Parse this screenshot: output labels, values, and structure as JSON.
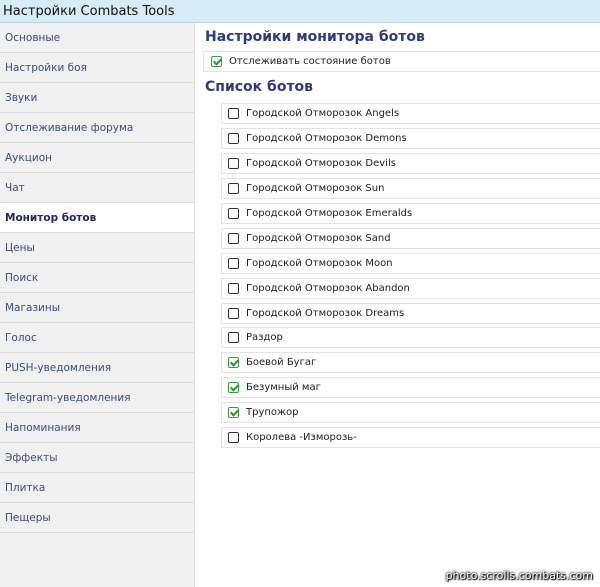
{
  "window": {
    "title": "Настройки Combats Tools"
  },
  "sidebar": {
    "items": [
      {
        "label": "Основные",
        "active": false
      },
      {
        "label": "Настройки боя",
        "active": false
      },
      {
        "label": "Звуки",
        "active": false
      },
      {
        "label": "Отслеживание форума",
        "active": false
      },
      {
        "label": "Аукцион",
        "active": false
      },
      {
        "label": "Чат",
        "active": false
      },
      {
        "label": "Монитор ботов",
        "active": true
      },
      {
        "label": "Цены",
        "active": false
      },
      {
        "label": "Поиск",
        "active": false
      },
      {
        "label": "Магазины",
        "active": false
      },
      {
        "label": "Голос",
        "active": false
      },
      {
        "label": "PUSH-уведомления",
        "active": false
      },
      {
        "label": "Telegram-уведомления",
        "active": false
      },
      {
        "label": "Напоминания",
        "active": false
      },
      {
        "label": "Эффекты",
        "active": false
      },
      {
        "label": "Плитка",
        "active": false
      },
      {
        "label": "Пещеры",
        "active": false
      }
    ]
  },
  "main": {
    "monitor_title": "Настройки монитора ботов",
    "tracking": {
      "label": "Отслеживать состояние ботов",
      "checked": true
    },
    "bots_title": "Список ботов",
    "bots": [
      {
        "label": "Городской Отморозок Angels",
        "checked": false
      },
      {
        "label": "Городской Отморозок Demons",
        "checked": false
      },
      {
        "label": "Городской Отморозок Devils",
        "checked": false
      },
      {
        "label": "Городской Отморозок Sun",
        "checked": false
      },
      {
        "label": "Городской Отморозок Emeralds",
        "checked": false
      },
      {
        "label": "Городской Отморозок Sand",
        "checked": false
      },
      {
        "label": "Городской Отморозок Moon",
        "checked": false
      },
      {
        "label": "Городской Отморозок Abandon",
        "checked": false
      },
      {
        "label": "Городской Отморозок Dreams",
        "checked": false
      },
      {
        "label": "Раздор",
        "checked": false
      },
      {
        "label": "Боевой Бугаг",
        "checked": true
      },
      {
        "label": "Безумный маг",
        "checked": true
      },
      {
        "label": "Трупожор",
        "checked": true
      },
      {
        "label": "Королева -Изморозь-",
        "checked": false
      }
    ]
  },
  "watermark": "photo.scrolls.combats.com",
  "colors": {
    "accent": "#2e3b84",
    "sidebar_bg": "#f1f1f1",
    "titlebar_bg": "#d8ecf7",
    "check": "#2d962d"
  }
}
